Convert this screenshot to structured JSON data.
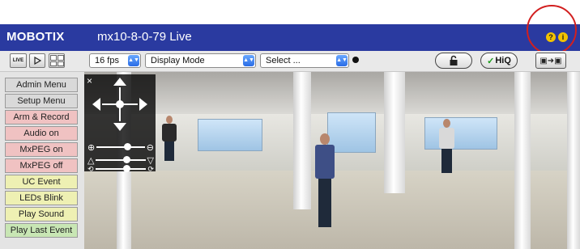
{
  "header": {
    "brand": "MOBOTIX",
    "title": "mx10-8-0-79 Live",
    "help_icons": [
      "?",
      "i"
    ]
  },
  "toolbar": {
    "live_label": "LIVE",
    "fps_value": "16 fps",
    "display_mode_value": "Display Mode",
    "select_value": "Select ...",
    "hiq_label": "HiQ",
    "export_label": "▣➜▣"
  },
  "sidebar": {
    "items": [
      {
        "label": "Admin Menu",
        "color": "#d9d9d9"
      },
      {
        "label": "Setup Menu",
        "color": "#d9d9d9"
      },
      {
        "label": "Arm & Record",
        "color": "#f0c2c2"
      },
      {
        "label": "Audio on",
        "color": "#f0c2c2"
      },
      {
        "label": "MxPEG on",
        "color": "#f0c2c2"
      },
      {
        "label": "MxPEG off",
        "color": "#f0c2c2"
      },
      {
        "label": "UC Event",
        "color": "#eef0b3"
      },
      {
        "label": "LEDs Blink",
        "color": "#eef0b3"
      },
      {
        "label": "Play Sound",
        "color": "#eef0b3"
      },
      {
        "label": "Play Last Event",
        "color": "#c8e6b4"
      }
    ]
  },
  "ptz": {
    "close": "×",
    "zoom_in": "⊕",
    "zoom_out": "⊖"
  },
  "colors": {
    "titlebar": "#2a3aa0",
    "callout": "#d21f1f",
    "accent_select": "#2a6ce6"
  }
}
